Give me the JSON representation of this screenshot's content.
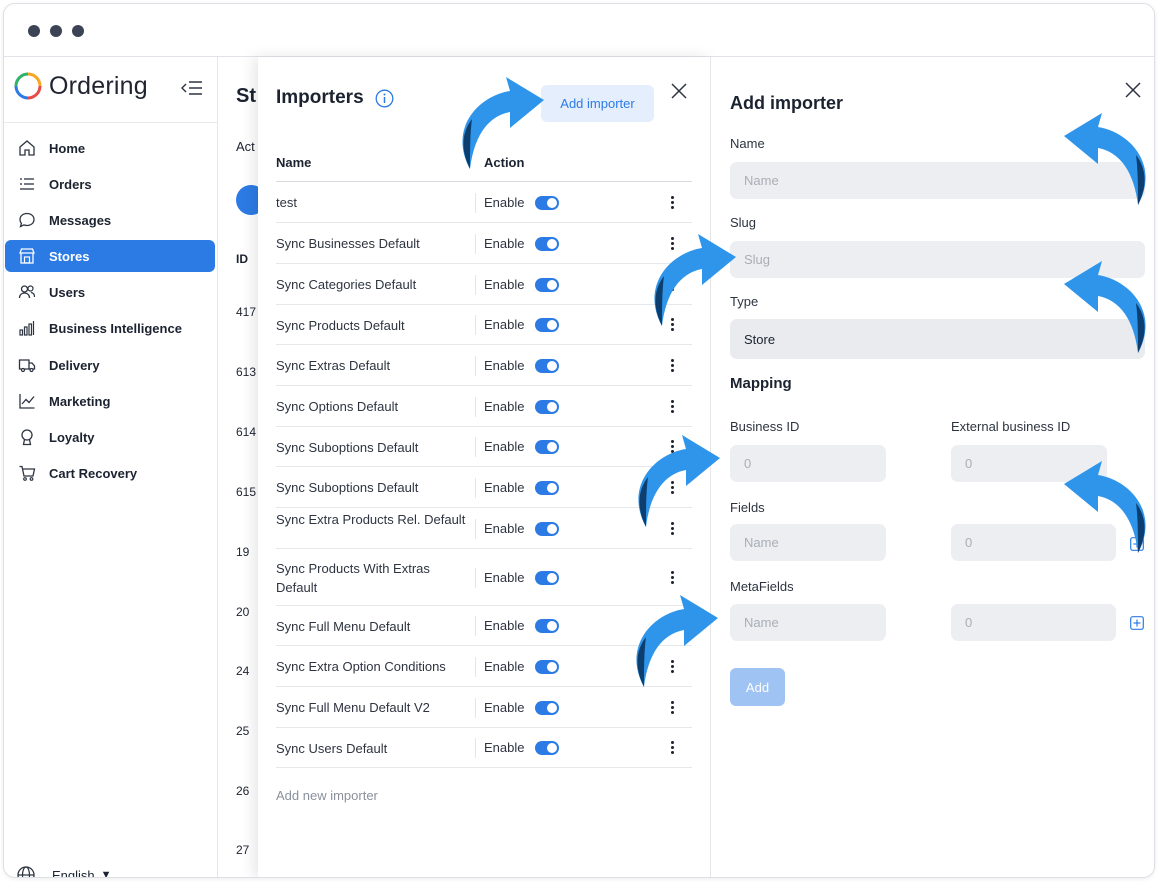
{
  "app": {
    "logo_text": "Ordering"
  },
  "sidebar": {
    "items": [
      {
        "label": "Home",
        "icon": "home-icon"
      },
      {
        "label": "Orders",
        "icon": "list-icon"
      },
      {
        "label": "Messages",
        "icon": "chat-icon"
      },
      {
        "label": "Stores",
        "icon": "store-icon",
        "active": true
      },
      {
        "label": "Users",
        "icon": "users-icon"
      },
      {
        "label": "Business Intelligence",
        "icon": "bar-chart-icon"
      },
      {
        "label": "Delivery",
        "icon": "truck-icon"
      },
      {
        "label": "Marketing",
        "icon": "trend-icon"
      },
      {
        "label": "Loyalty",
        "icon": "award-icon"
      },
      {
        "label": "Cart Recovery",
        "icon": "cart-icon"
      }
    ],
    "language": "English"
  },
  "background": {
    "title": "St",
    "tab": "Act",
    "id_header": "ID",
    "ids": [
      "417",
      "613",
      "614",
      "615",
      "19",
      "20",
      "24",
      "25",
      "26",
      "27"
    ]
  },
  "importers": {
    "title": "Importers",
    "add_button": "Add importer",
    "columns": {
      "name": "Name",
      "action": "Action"
    },
    "rows": [
      {
        "name": "test",
        "action": "Enable"
      },
      {
        "name": "Sync Businesses Default",
        "action": "Enable"
      },
      {
        "name": "Sync Categories Default",
        "action": "Enable"
      },
      {
        "name": "Sync Products Default",
        "action": "Enable"
      },
      {
        "name": "Sync Extras Default",
        "action": "Enable"
      },
      {
        "name": "Sync Options Default",
        "action": "Enable"
      },
      {
        "name": "Sync Suboptions Default",
        "action": "Enable"
      },
      {
        "name": "Sync Suboptions Default",
        "action": "Enable"
      },
      {
        "name": "Sync Extra Products Rel. Default",
        "action": "Enable"
      },
      {
        "name": "Sync Products With Extras Default",
        "action": "Enable"
      },
      {
        "name": "Sync Full Menu Default",
        "action": "Enable"
      },
      {
        "name": "Sync Extra Option Conditions",
        "action": "Enable"
      },
      {
        "name": "Sync Full Menu Default V2",
        "action": "Enable"
      },
      {
        "name": "Sync Users Default",
        "action": "Enable"
      }
    ],
    "add_new": "Add new importer"
  },
  "form": {
    "title": "Add importer",
    "name_label": "Name",
    "name_placeholder": "Name",
    "slug_label": "Slug",
    "slug_placeholder": "Slug",
    "type_label": "Type",
    "type_value": "Store",
    "mapping_title": "Mapping",
    "business_id_label": "Business ID",
    "business_id_placeholder": "0",
    "external_business_id_label": "External business ID",
    "external_business_id_placeholder": "0",
    "fields_label": "Fields",
    "fields_name_placeholder": "Name",
    "fields_value_placeholder": "0",
    "metafields_label": "MetaFields",
    "metafields_name_placeholder": "Name",
    "metafields_value_placeholder": "0",
    "submit_label": "Add"
  },
  "colors": {
    "accent": "#2c7be5",
    "arrow": "#2f95ea",
    "arrow_shadow": "#0d3e70"
  }
}
